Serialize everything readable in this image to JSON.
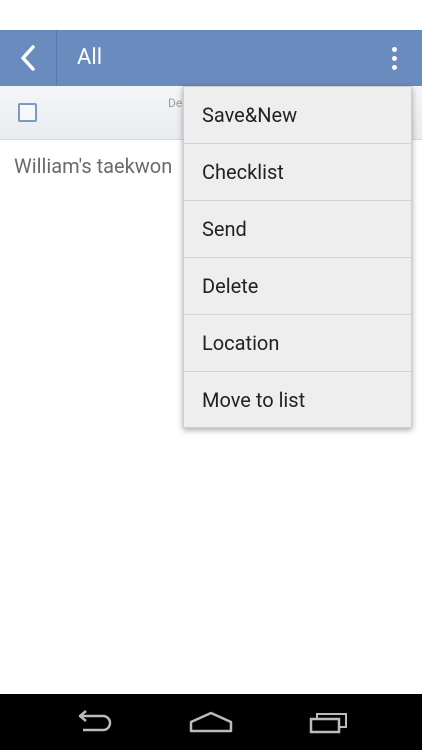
{
  "header": {
    "title": "All",
    "back_icon": "chevron-left-icon",
    "overflow_icon": "more-vertical-icon",
    "color": "#6a8bbd"
  },
  "subbar": {
    "partial_label": "De"
  },
  "notes": [
    {
      "title": "William's taekwon"
    }
  ],
  "menu": {
    "items": [
      {
        "label": "Save&New"
      },
      {
        "label": "Checklist"
      },
      {
        "label": "Send"
      },
      {
        "label": "Delete"
      },
      {
        "label": "Location"
      },
      {
        "label": "Move to list"
      }
    ]
  },
  "nav": {
    "back_icon": "back-arrow-icon",
    "home_icon": "home-icon",
    "recents_icon": "recent-apps-icon"
  }
}
